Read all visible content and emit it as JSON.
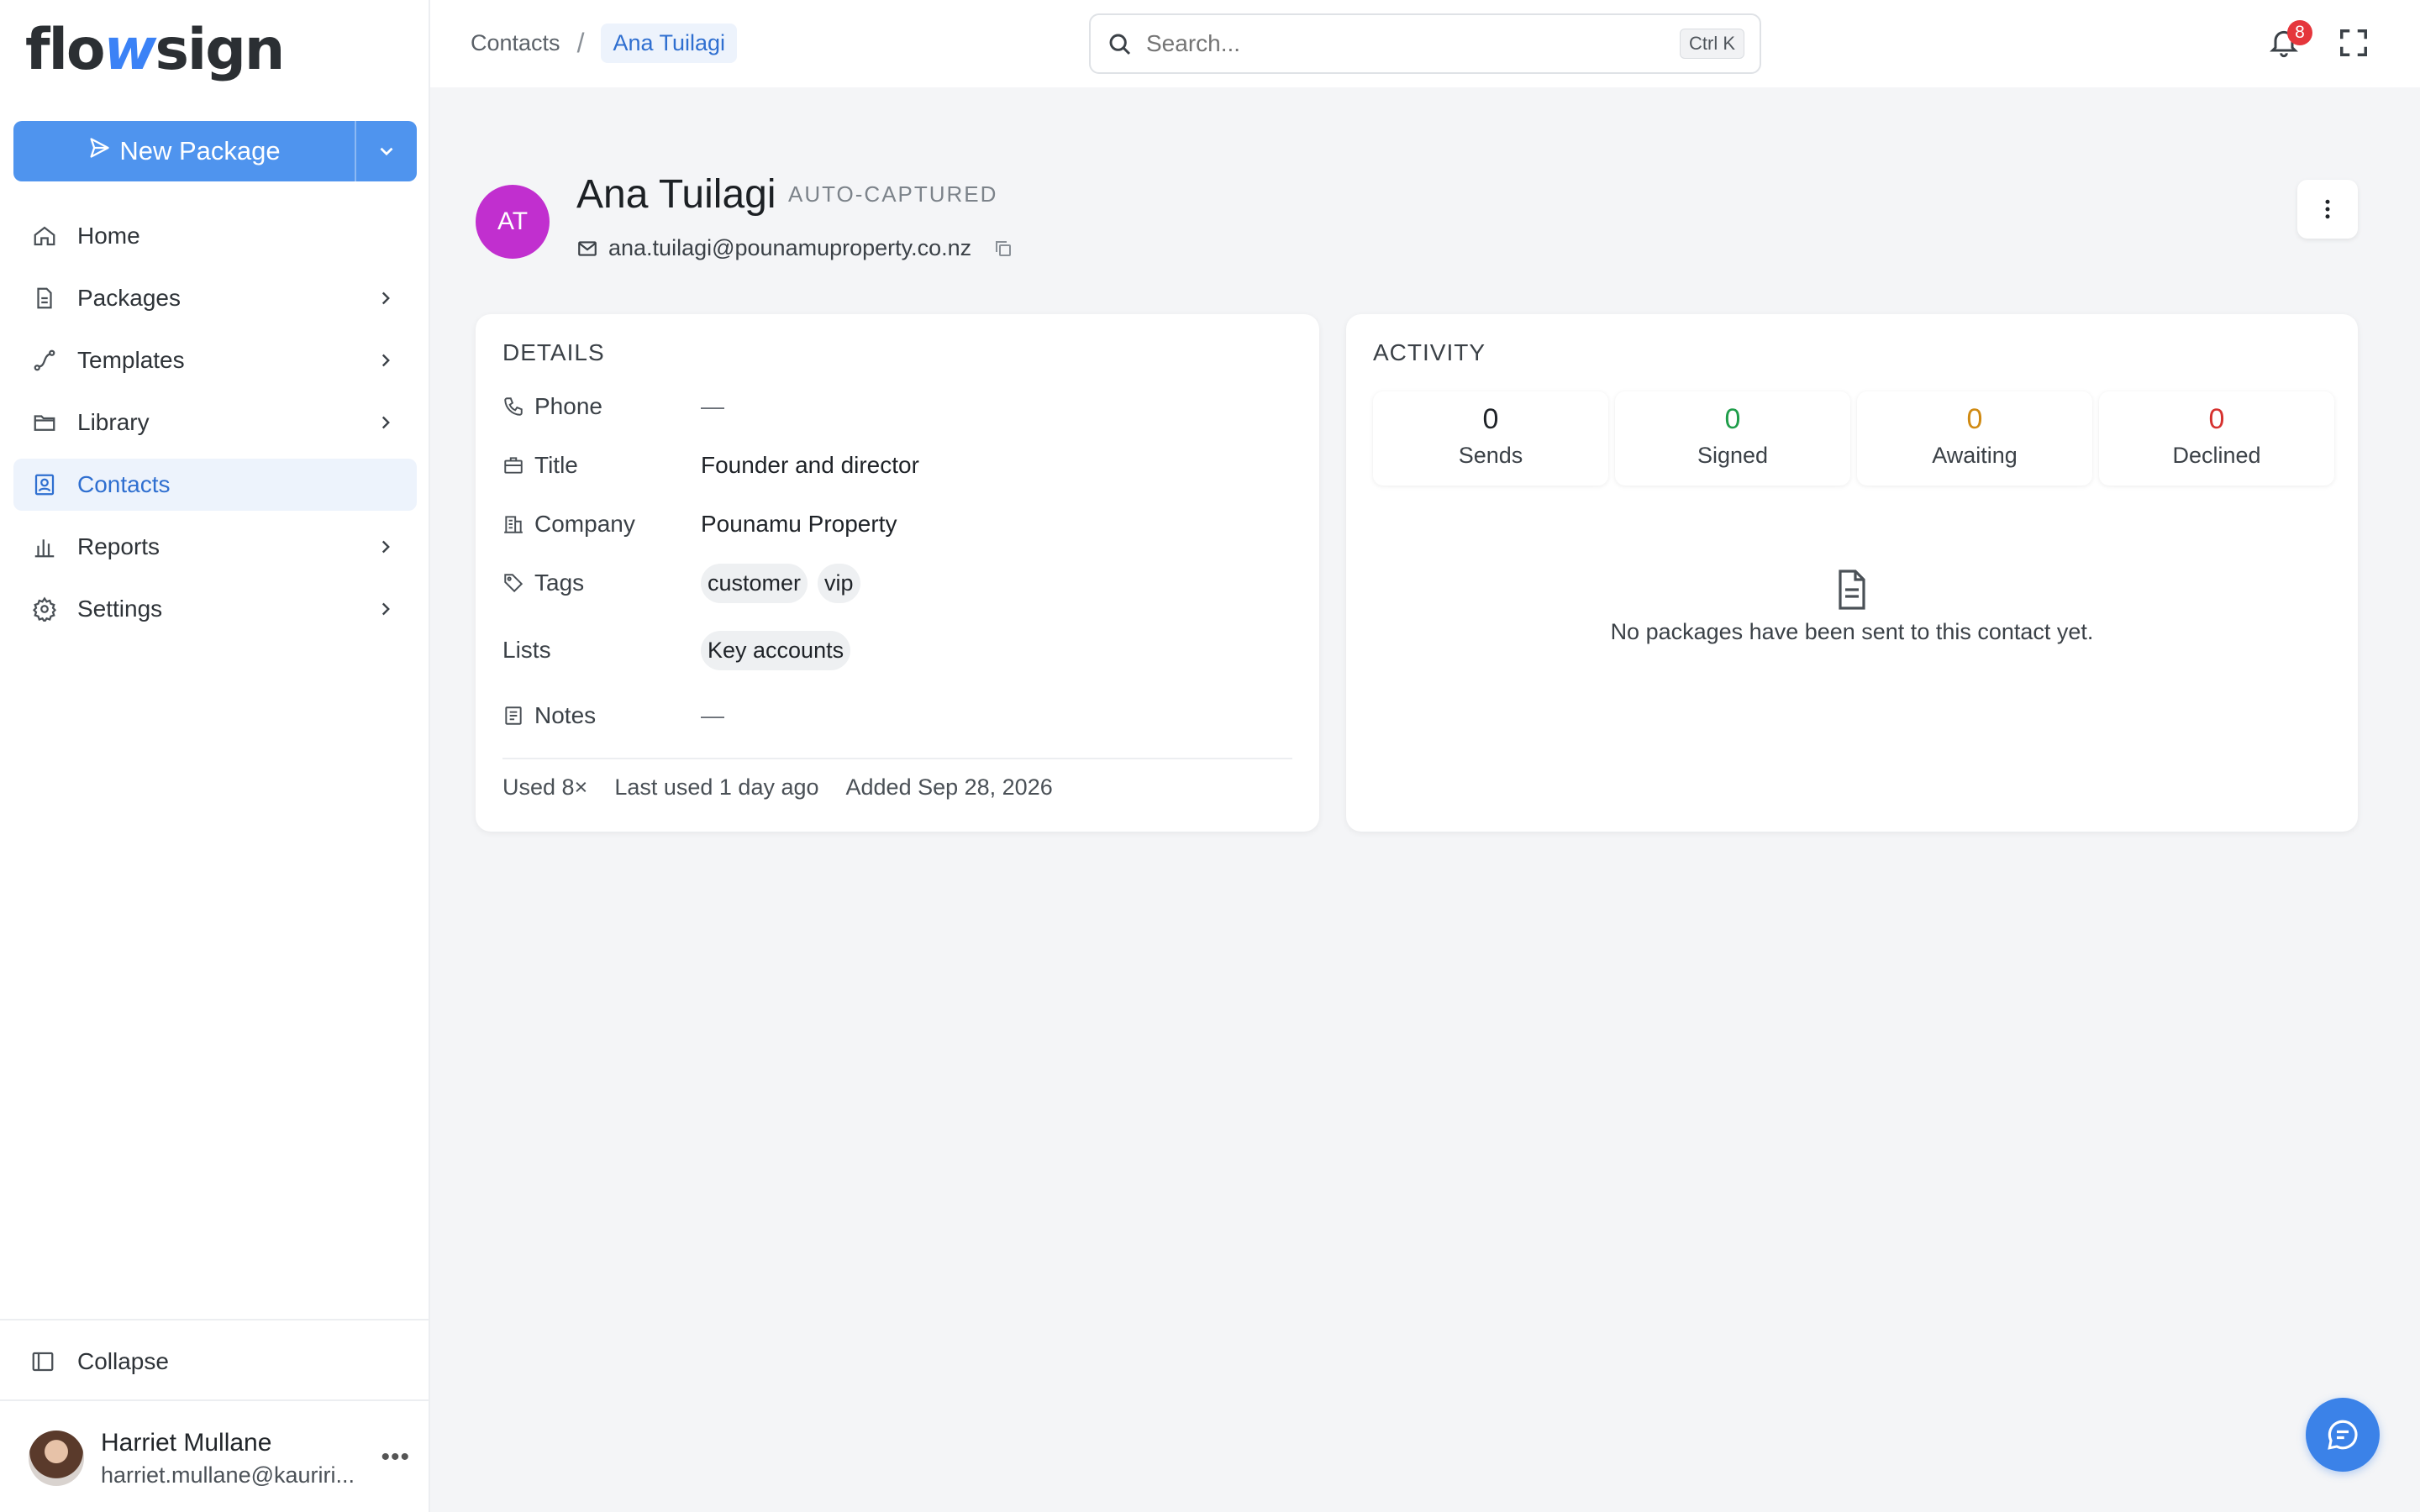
{
  "brand": {
    "logo_left": "flo",
    "logo_mid": "w",
    "logo_right": "sign",
    "accent": "#4f94ee"
  },
  "sidebar": {
    "new_package_label": "New Package",
    "items": [
      {
        "label": "Home",
        "icon": "home-icon"
      },
      {
        "label": "Packages",
        "icon": "document-icon"
      },
      {
        "label": "Templates",
        "icon": "route-icon"
      },
      {
        "label": "Library",
        "icon": "folder-icon"
      },
      {
        "label": "Contacts",
        "icon": "contact-book-icon",
        "active": true
      },
      {
        "label": "Reports",
        "icon": "bar-chart-icon"
      },
      {
        "label": "Settings",
        "icon": "gear-icon"
      }
    ],
    "collapse_label": "Collapse",
    "user": {
      "name": "Harriet Mullane",
      "email": "harriet.mullane@kauriri..."
    }
  },
  "topbar": {
    "breadcrumb": [
      "Contacts",
      "Ana Tuilagi"
    ],
    "breadcrumb_sep": "/",
    "search_placeholder": "Search...",
    "search_shortcut": "Ctrl K",
    "notification_count": "8"
  },
  "contact": {
    "initials": "AT",
    "avatar_color": "#c12fcf",
    "name": "Ana Tuilagi",
    "tag": "AUTO-CAPTURED",
    "email": "ana.tuilagi@pounamuproperty.co.nz"
  },
  "details": {
    "title": "DETAILS",
    "phone_label": "Phone",
    "phone_value": "—",
    "title_label": "Title",
    "title_value": "Founder and director",
    "company_label": "Company",
    "company_value": "Pounamu Property",
    "tags_label": "Tags",
    "tags": [
      "customer",
      "vip"
    ],
    "lists_label": "Lists",
    "lists": [
      "Key accounts"
    ],
    "notes_label": "Notes",
    "notes_value": "—",
    "footer": {
      "used": "Used 8×",
      "last_used": "Last used 1 day ago",
      "added": "Added Sep 28, 2026"
    }
  },
  "activity": {
    "title": "ACTIVITY",
    "stats": [
      {
        "value": "0",
        "label": "Sends",
        "color": "#1f2328"
      },
      {
        "value": "0",
        "label": "Signed",
        "color": "#1f9d4a"
      },
      {
        "value": "0",
        "label": "Awaiting",
        "color": "#d08a12"
      },
      {
        "value": "0",
        "label": "Declined",
        "color": "#d6322f"
      }
    ],
    "empty_message": "No packages have been sent to this contact yet."
  }
}
